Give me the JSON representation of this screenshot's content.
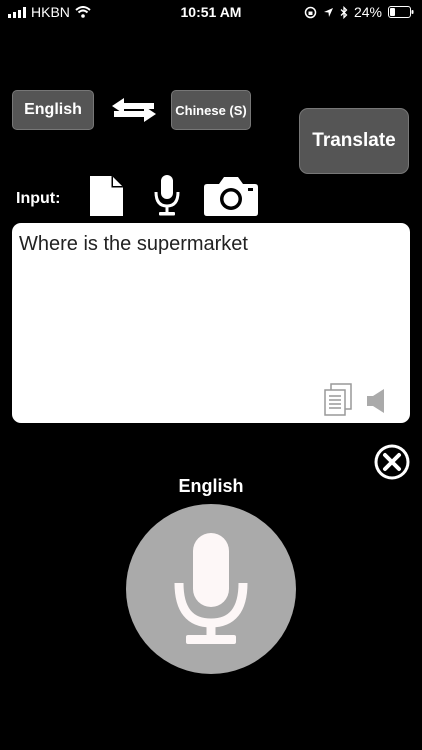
{
  "status_bar": {
    "carrier": "HKBN",
    "time": "10:51 AM",
    "battery": "24%"
  },
  "languages": {
    "source": "English",
    "target": "Chinese (S)"
  },
  "translate_label": "Translate",
  "input_label": "Input:",
  "input_text": "Where is the supermarket",
  "mic_language": "English",
  "icons": [
    "signal-icon",
    "wifi-icon",
    "lock-rotation-icon",
    "location-icon",
    "bluetooth-icon",
    "battery-icon",
    "swap-arrows-icon",
    "file-icon",
    "microphone-icon",
    "camera-icon",
    "copy-icon",
    "speaker-icon",
    "close-icon"
  ],
  "colors": {
    "background": "#000000",
    "button": "#555555",
    "panel": "#ffffff",
    "mic_circle": "#aaaaaa"
  }
}
